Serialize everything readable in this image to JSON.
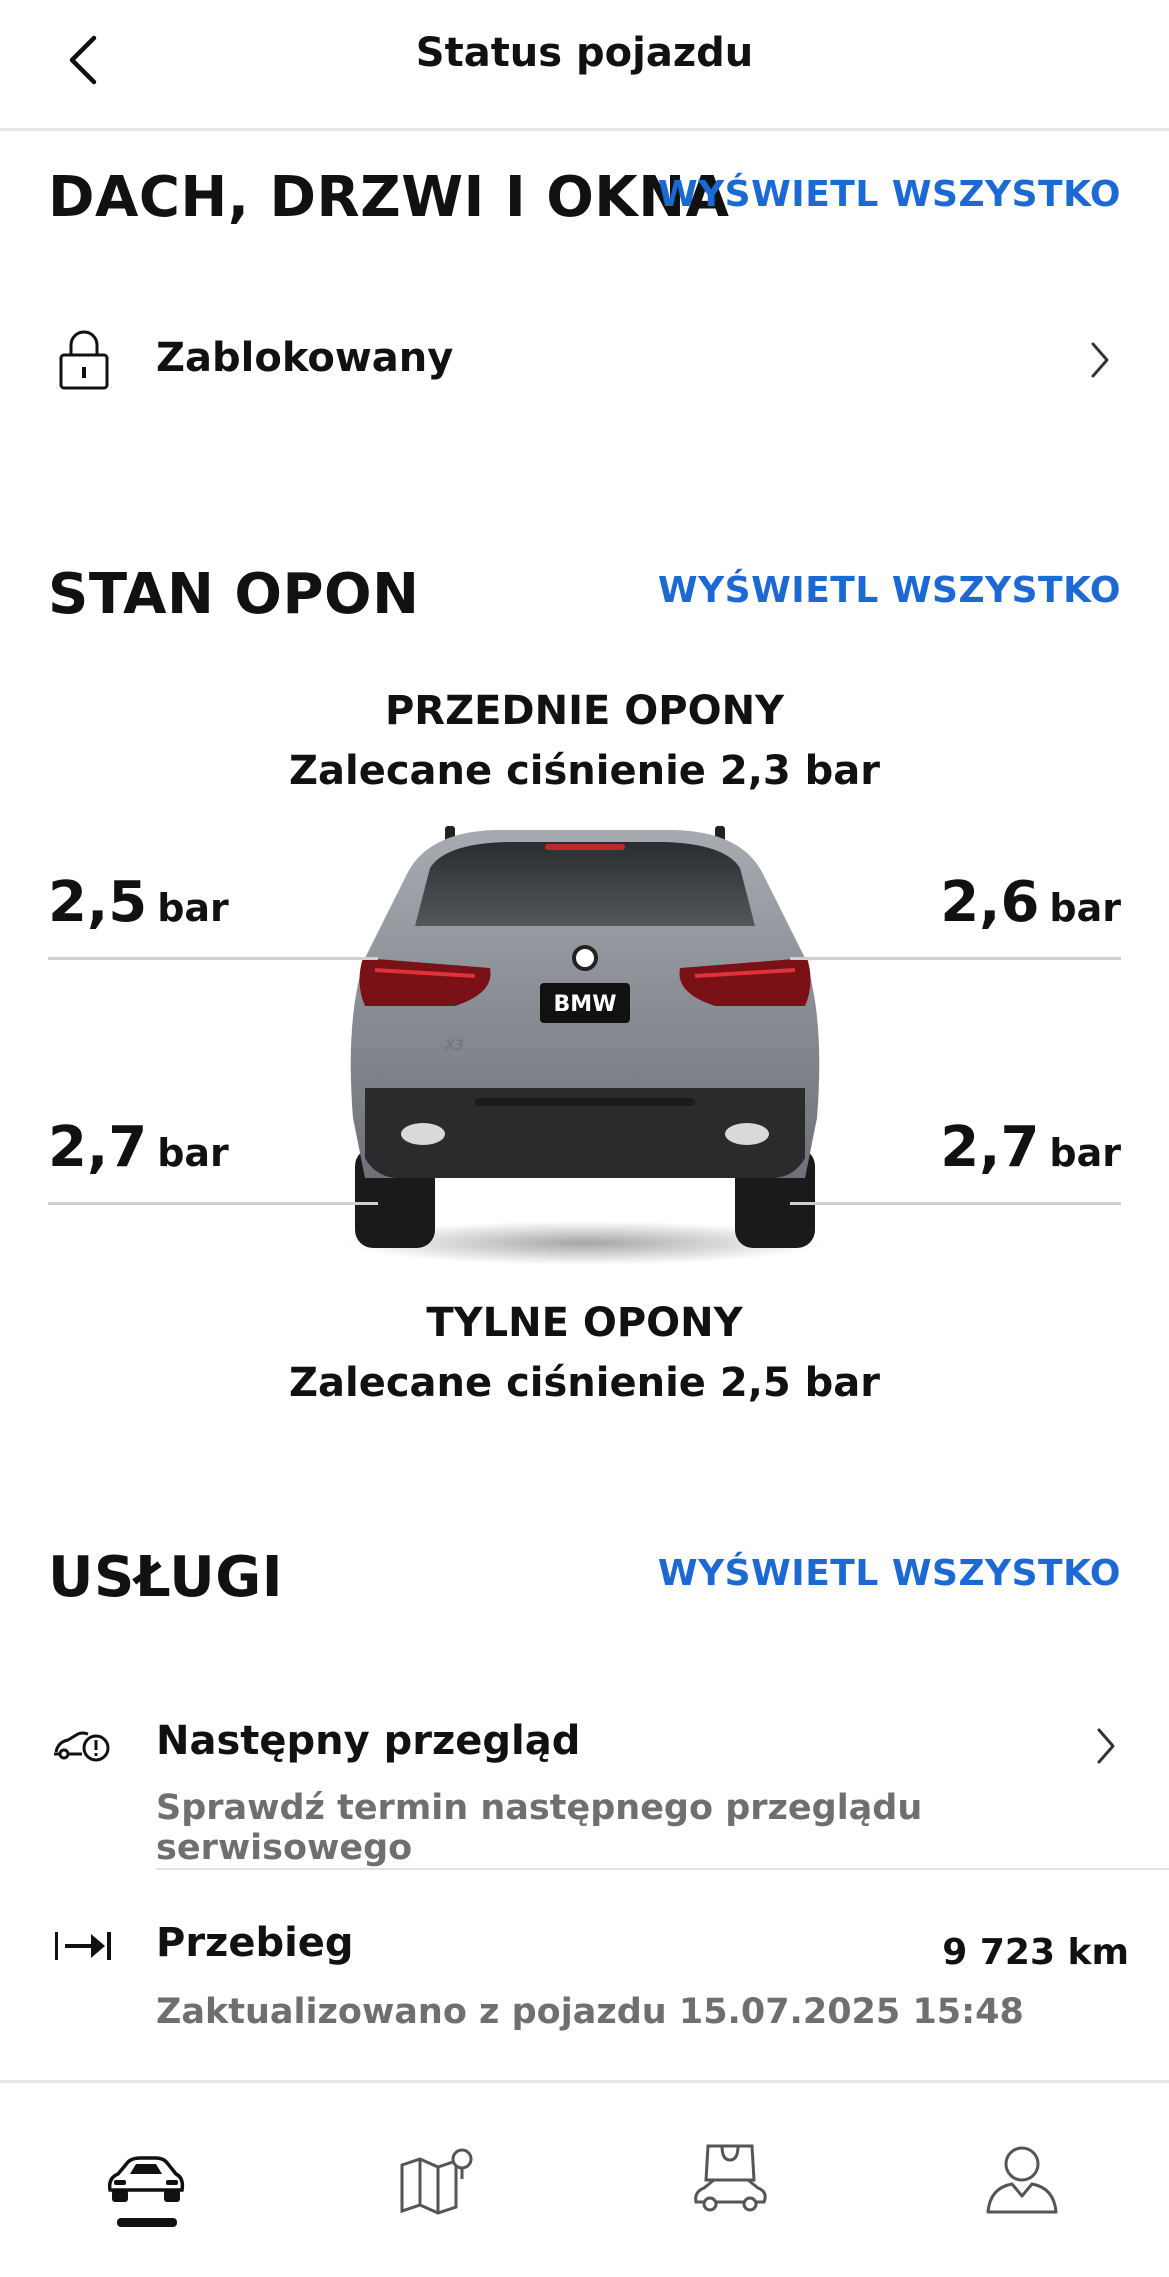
{
  "header": {
    "title": "Status pojazdu",
    "back_icon": "chevron-left-icon"
  },
  "doors": {
    "title": "DACH, DRZWI I OKNA",
    "view_all": "WYŚWIETL WSZYSTKO",
    "status_label": "Zablokowany",
    "icon": "padlock-closed-icon"
  },
  "tyres": {
    "title": "STAN OPON",
    "view_all": "WYŚWIETL WSZYSTKO",
    "front_title": "PRZEDNIE OPONY",
    "front_recommended": "Zalecane ciśnienie 2,3 bar",
    "rear_title": "TYLNE OPONY",
    "rear_recommended": "Zalecane ciśnienie 2,5 bar",
    "front_left": {
      "value": "2,5",
      "unit": "bar"
    },
    "front_right": {
      "value": "2,6",
      "unit": "bar"
    },
    "rear_left": {
      "value": "2,7",
      "unit": "bar"
    },
    "rear_right": {
      "value": "2,7",
      "unit": "bar"
    },
    "car_badge": "BMW",
    "car_model": "X3",
    "car_color": "#8c9096"
  },
  "services": {
    "title": "USŁUGI",
    "view_all": "WYŚWIETL WSZYSTKO",
    "next_service": {
      "label": "Następny przegląd",
      "sub": "Sprawdź termin następnego przeglądu serwisowego",
      "icon": "car-service-warning-icon"
    },
    "mileage": {
      "label": "Przebieg",
      "sub": "Zaktualizowano z pojazdu 15.07.2025 15:48",
      "value": "9 723 km",
      "icon": "arrow-to-line-icon"
    }
  },
  "tabbar": {
    "tabs": [
      {
        "name": "vehicle",
        "icon": "car-icon",
        "active": true
      },
      {
        "name": "map",
        "icon": "map-pin-icon",
        "active": false
      },
      {
        "name": "shop",
        "icon": "shopping-bag-car-icon",
        "active": false
      },
      {
        "name": "profile",
        "icon": "person-icon",
        "active": false
      }
    ]
  },
  "colors": {
    "accent": "#1c69d4",
    "text": "#111111",
    "secondary": "#6f6f6f",
    "divider": "#e2e2e2"
  }
}
